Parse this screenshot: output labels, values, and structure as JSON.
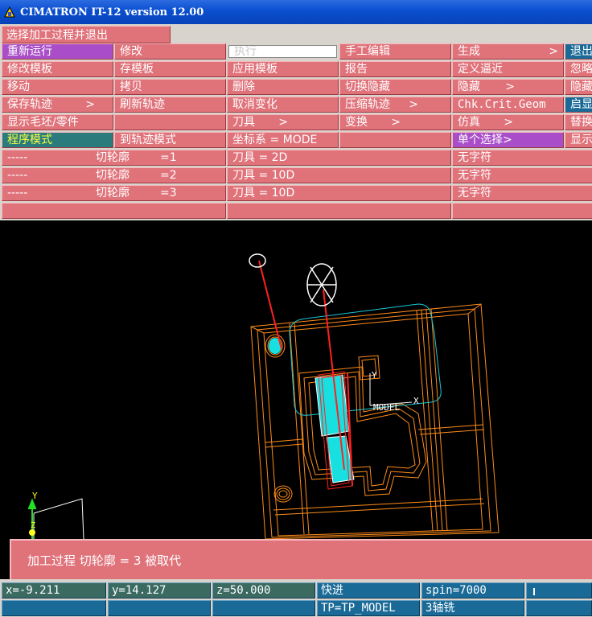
{
  "window": {
    "title": "CIMATRON IT-12 version 12.00",
    "icon": "cimatron-app-icon"
  },
  "top_button": "选择加工过程并退出",
  "menu": {
    "col1": [
      "重新运行",
      "修改模板",
      "移动",
      "保存轨迹",
      "显示毛坯/零件",
      "程序模式"
    ],
    "col1_arrow_row": 3,
    "col2": [
      "修改",
      "存模板",
      "拷贝",
      "刷新轨迹",
      "",
      "到轨迹模式"
    ],
    "col3": [
      "执行",
      "应用模板",
      "删除",
      "取消变化",
      "刀具",
      "坐标系 = MODE"
    ],
    "col4": [
      "手工编辑",
      "报告",
      "切换隐藏",
      "压缩轨迹",
      "变换",
      ""
    ],
    "col5": [
      "生成",
      "定义逼近",
      "隐藏",
      "Chk.Crit.Geom",
      "仿真",
      "单个选择"
    ],
    "col6": [
      "退出",
      "忽略",
      "隐藏",
      "启显",
      "替换",
      "显示"
    ],
    "arrow_glyph": ">",
    "rows": [
      {
        "dashes": "-----",
        "name": "切轮廓",
        "num": "=1",
        "tool": "刀具 = 2D",
        "char": "无字符"
      },
      {
        "dashes": "-----",
        "name": "切轮廓",
        "num": "=2",
        "tool": "刀具 = 10D",
        "char": "无字符"
      },
      {
        "dashes": "-----",
        "name": "切轮廓",
        "num": "=3",
        "tool": "刀具 = 10D",
        "char": "无字符"
      }
    ]
  },
  "viewport": {
    "model_label": "MODEL",
    "axis_x": "X",
    "axis_y": "Y",
    "axis_z": "Z",
    "triad_y": "Y",
    "triad_z": "Z",
    "colors": {
      "wire": "#ff8c1a",
      "toolpath": "#ff2020",
      "surface": "#19e0e0",
      "bg": "#000000"
    }
  },
  "message": "加工过程 切轮廓 = 3 被取代",
  "status": {
    "x": "x=-9.211",
    "y": "y=14.127",
    "z": "z=50.000",
    "mode": "快进",
    "spin": "spin=7000",
    "tp": "TP=TP_MODEL",
    "axis": "3轴铣"
  },
  "colors": {
    "button": "#e0727a",
    "selected": "#a94ec8",
    "status": "#1a6a98",
    "titlebar": "#0a4fd0"
  }
}
